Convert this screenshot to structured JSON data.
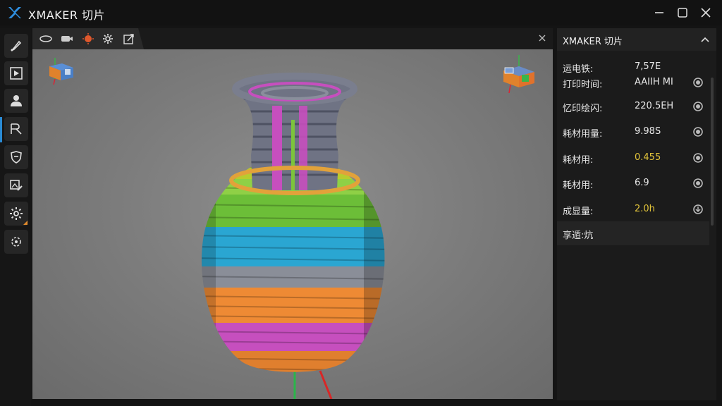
{
  "window": {
    "title": "XMAKER 切片",
    "logo_icon": "x-logo-icon",
    "controls": [
      "minimize-icon",
      "maximize-icon",
      "close-icon"
    ]
  },
  "left_toolbar": {
    "tools": [
      "brush-icon",
      "play-panel-icon",
      "user-icon",
      "select-cursor-icon",
      "shield-icon",
      "image-edit-icon",
      "gear-icon",
      "dashed-gear-icon"
    ],
    "active_index": 3
  },
  "viewport_tabs": {
    "icons": [
      "orbit-icon",
      "camera-icon",
      "light-icon",
      "settings-icon",
      "export-icon"
    ],
    "close_icon": "close-icon"
  },
  "model": {
    "description_colors": [
      "#7a7e8e",
      "#c64fc0",
      "#ef8c34",
      "#2aa8d4",
      "#7cc43c",
      "#bcd02c"
    ]
  },
  "panel": {
    "title": "XMAKER 切片",
    "collapse_icon": "chevron-up-icon",
    "rows": [
      {
        "label": "运电铁:",
        "value": "7,57E",
        "icon": ""
      },
      {
        "label": "打印时间:",
        "value": "AAIIH MI",
        "icon": "radio-icon"
      },
      {
        "label": "忆印绘闪:",
        "value": "220.5EH",
        "icon": "radio-icon"
      },
      {
        "label": "耗材用量:",
        "value": "9.98S",
        "icon": "radio-icon"
      },
      {
        "label": "耗材用:",
        "value": "0.455",
        "icon": "radio-icon",
        "highlight": true
      },
      {
        "label": "耗材用:",
        "value": "6.9",
        "icon": "radio-icon"
      },
      {
        "label": "成显量:",
        "value": "2.0h",
        "icon": "download-icon",
        "highlight": true
      }
    ],
    "footer": "享遁:炕"
  },
  "colors": {
    "accent": "#2a8ad4",
    "highlight": "#e2c43a",
    "panel_bg": "#1b1b1b"
  }
}
